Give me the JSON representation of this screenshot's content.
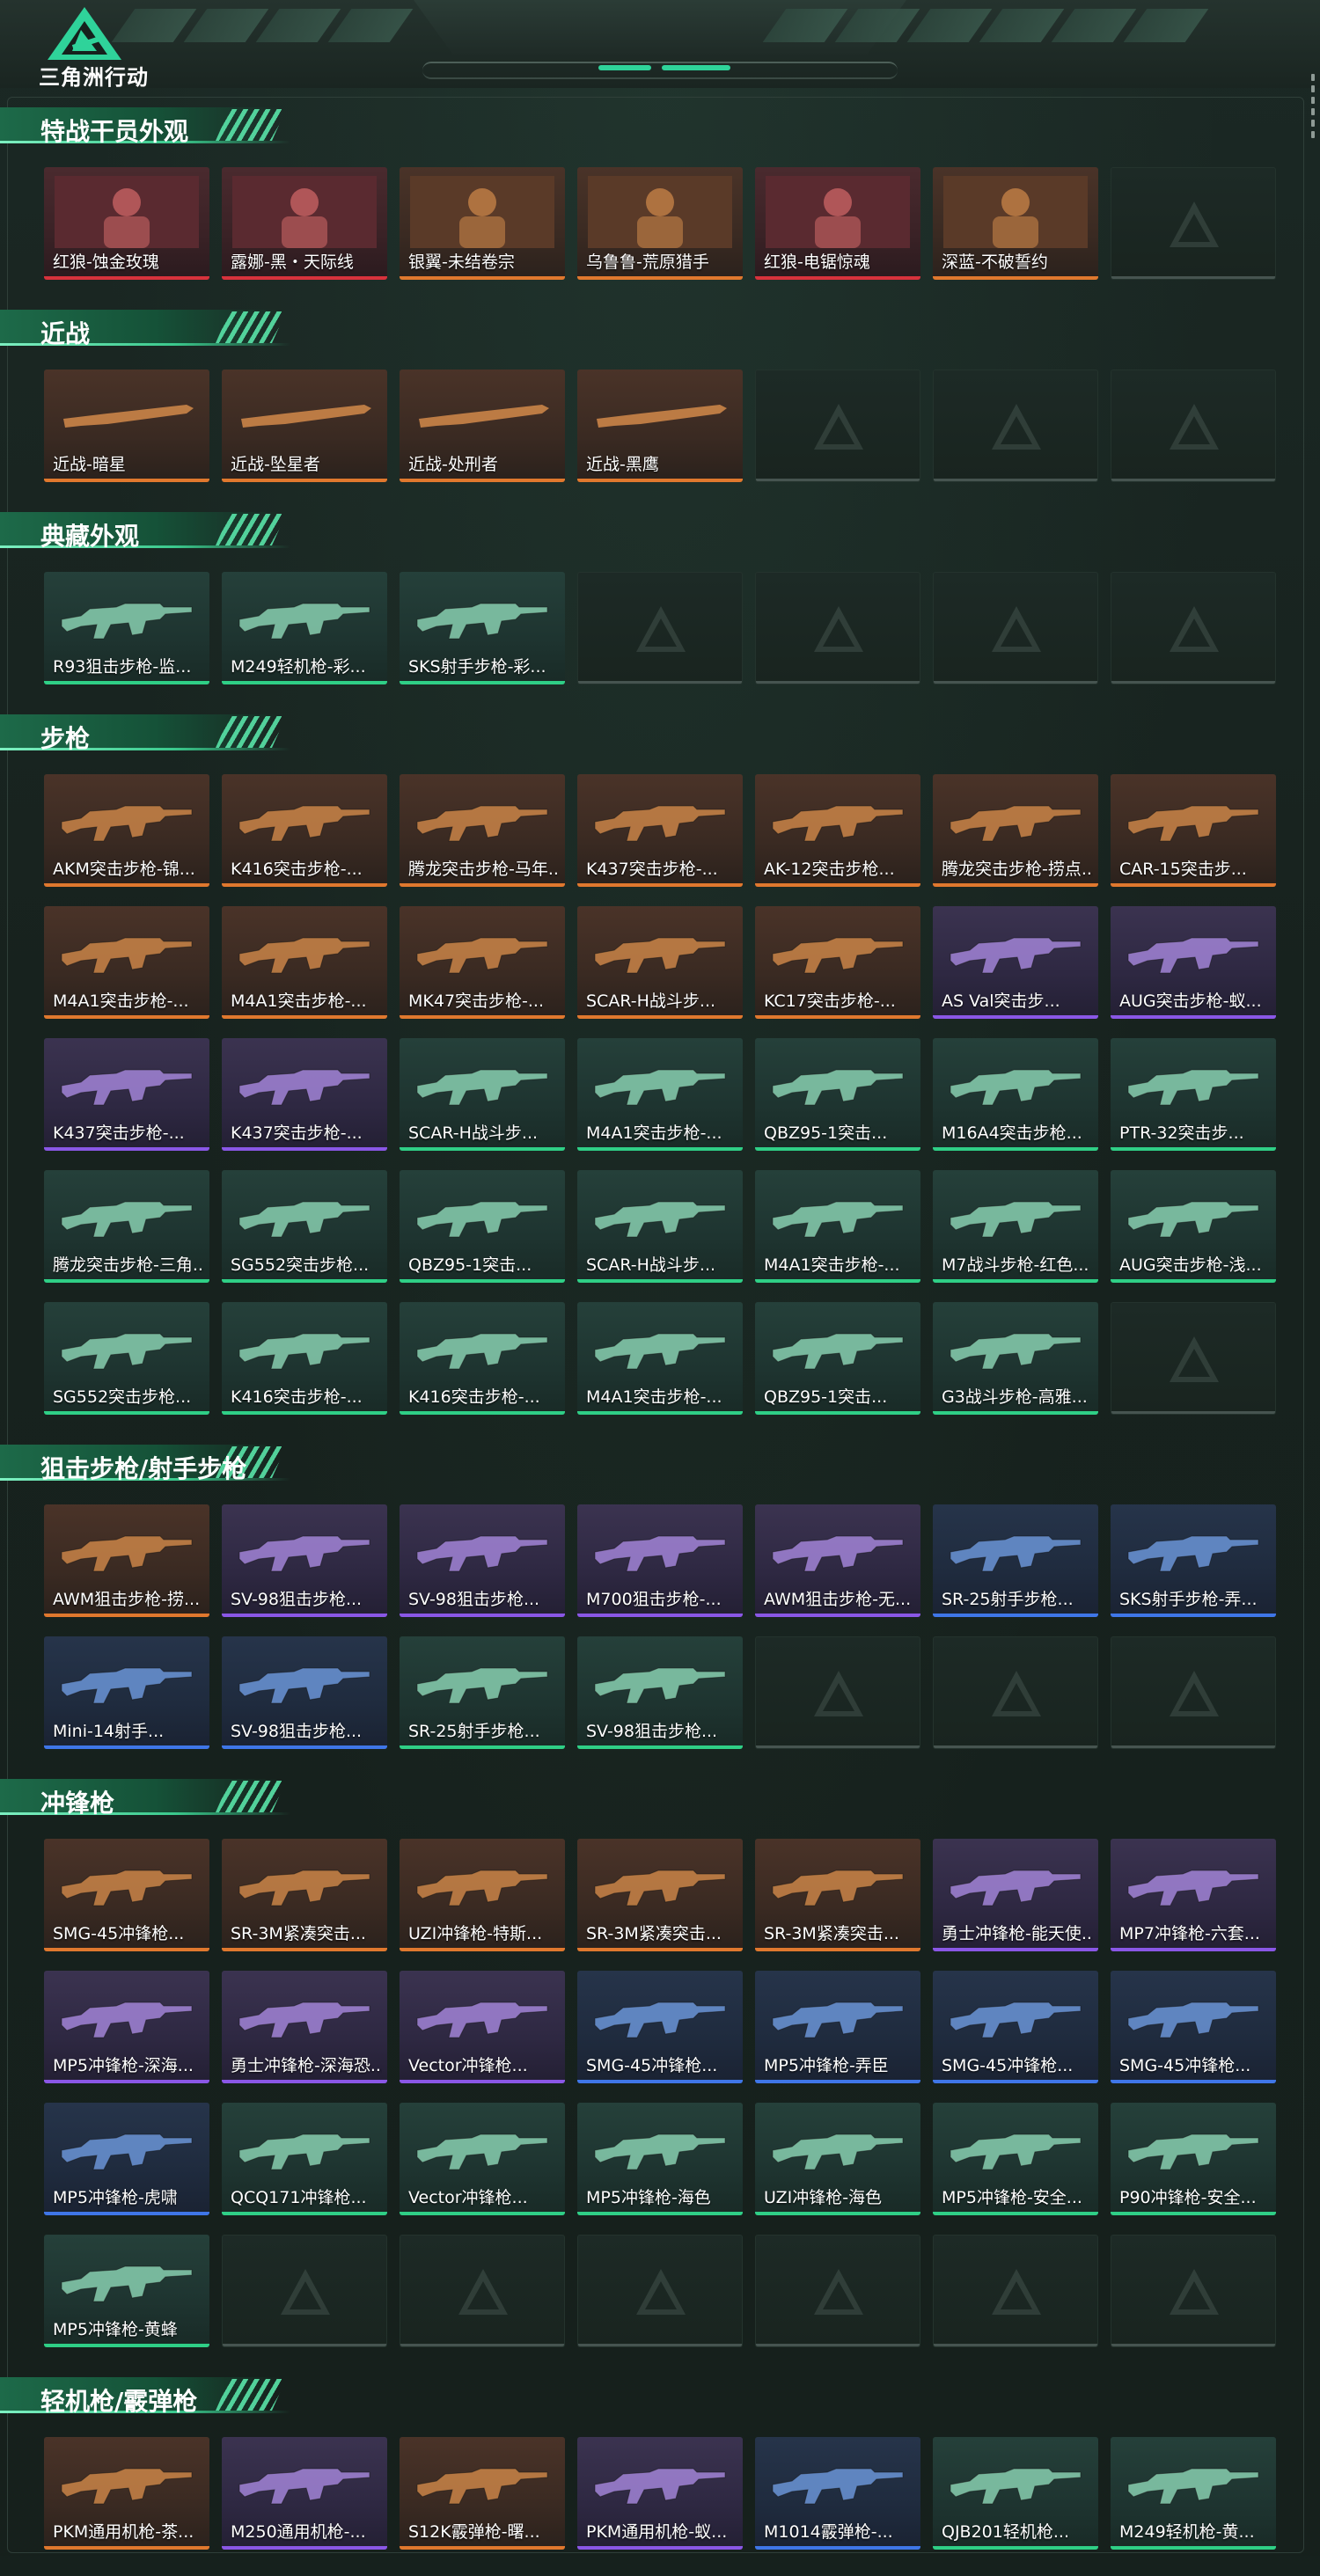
{
  "app": {
    "logo_text": "三角洲行动"
  },
  "colors": {
    "orange": "#e0782e",
    "red": "#d8323c",
    "purple": "#8a57e6",
    "blue": "#3f76e8",
    "green": "#2fcf86",
    "gray": "#bfc6c4",
    "accent": "#2fd39a"
  },
  "sections": [
    {
      "title": "特战干员外观",
      "items": [
        {
          "label": "红狼-蚀金玫瑰",
          "rarity": "red"
        },
        {
          "label": "露娜-黑・天际线",
          "rarity": "red"
        },
        {
          "label": "银翼-未结卷宗",
          "rarity": "orange"
        },
        {
          "label": "乌鲁鲁-荒原猎手",
          "rarity": "orange"
        },
        {
          "label": "红狼-电锯惊魂",
          "rarity": "red"
        },
        {
          "label": "深蓝-不破誓约",
          "rarity": "orange"
        },
        {
          "label": "",
          "rarity": "empty"
        }
      ]
    },
    {
      "title": "近战",
      "items": [
        {
          "label": "近战-暗星",
          "rarity": "orange"
        },
        {
          "label": "近战-坠星者",
          "rarity": "orange"
        },
        {
          "label": "近战-处刑者",
          "rarity": "orange"
        },
        {
          "label": "近战-黑鹰",
          "rarity": "orange"
        },
        {
          "label": "",
          "rarity": "empty"
        },
        {
          "label": "",
          "rarity": "empty"
        },
        {
          "label": "",
          "rarity": "empty"
        }
      ]
    },
    {
      "title": "典藏外观",
      "items": [
        {
          "label": "R93狙击步枪-监...",
          "rarity": "green"
        },
        {
          "label": "M249轻机枪-彩...",
          "rarity": "green"
        },
        {
          "label": "SKS射手步枪-彩...",
          "rarity": "green"
        },
        {
          "label": "",
          "rarity": "empty"
        },
        {
          "label": "",
          "rarity": "empty"
        },
        {
          "label": "",
          "rarity": "empty"
        },
        {
          "label": "",
          "rarity": "empty"
        }
      ]
    },
    {
      "title": "步枪",
      "items": [
        {
          "label": "AKM突击步枪-锦...",
          "rarity": "orange"
        },
        {
          "label": "K416突击步枪-...",
          "rarity": "orange"
        },
        {
          "label": "腾龙突击步枪-马年...",
          "rarity": "orange"
        },
        {
          "label": "K437突击步枪-...",
          "rarity": "orange"
        },
        {
          "label": "AK-12突击步枪...",
          "rarity": "orange"
        },
        {
          "label": "腾龙突击步枪-捞点...",
          "rarity": "orange"
        },
        {
          "label": "CAR-15突击步...",
          "rarity": "orange"
        },
        {
          "label": "M4A1突击步枪-...",
          "rarity": "orange"
        },
        {
          "label": "M4A1突击步枪-...",
          "rarity": "orange"
        },
        {
          "label": "MK47突击步枪-...",
          "rarity": "orange"
        },
        {
          "label": "SCAR-H战斗步...",
          "rarity": "orange"
        },
        {
          "label": "KC17突击步枪-...",
          "rarity": "orange"
        },
        {
          "label": "AS Val突击步...",
          "rarity": "purple"
        },
        {
          "label": "AUG突击步枪-蚁...",
          "rarity": "purple"
        },
        {
          "label": "K437突击步枪-...",
          "rarity": "purple"
        },
        {
          "label": "K437突击步枪-...",
          "rarity": "purple"
        },
        {
          "label": "SCAR-H战斗步...",
          "rarity": "green"
        },
        {
          "label": "M4A1突击步枪-...",
          "rarity": "green"
        },
        {
          "label": "QBZ95-1突击...",
          "rarity": "green"
        },
        {
          "label": "M16A4突击步枪...",
          "rarity": "green"
        },
        {
          "label": "PTR-32突击步...",
          "rarity": "green"
        },
        {
          "label": "腾龙突击步枪-三角...",
          "rarity": "green"
        },
        {
          "label": "SG552突击步枪...",
          "rarity": "green"
        },
        {
          "label": "QBZ95-1突击...",
          "rarity": "green"
        },
        {
          "label": "SCAR-H战斗步...",
          "rarity": "green"
        },
        {
          "label": "M4A1突击步枪-...",
          "rarity": "green"
        },
        {
          "label": "M7战斗步枪-红色...",
          "rarity": "green"
        },
        {
          "label": "AUG突击步枪-浅...",
          "rarity": "green"
        },
        {
          "label": "SG552突击步枪...",
          "rarity": "green"
        },
        {
          "label": "K416突击步枪-...",
          "rarity": "green"
        },
        {
          "label": "K416突击步枪-...",
          "rarity": "green"
        },
        {
          "label": "M4A1突击步枪-...",
          "rarity": "green"
        },
        {
          "label": "QBZ95-1突击...",
          "rarity": "green"
        },
        {
          "label": "G3战斗步枪-高雅...",
          "rarity": "green"
        },
        {
          "label": "",
          "rarity": "empty"
        }
      ]
    },
    {
      "title": "狙击步枪/射手步枪",
      "items": [
        {
          "label": "AWM狙击步枪-捞...",
          "rarity": "orange"
        },
        {
          "label": "SV-98狙击步枪...",
          "rarity": "purple"
        },
        {
          "label": "SV-98狙击步枪...",
          "rarity": "purple"
        },
        {
          "label": "M700狙击步枪-...",
          "rarity": "purple"
        },
        {
          "label": "AWM狙击步枪-无...",
          "rarity": "purple"
        },
        {
          "label": "SR-25射手步枪...",
          "rarity": "blue"
        },
        {
          "label": "SKS射手步枪-弄...",
          "rarity": "blue"
        },
        {
          "label": "Mini-14射手...",
          "rarity": "blue"
        },
        {
          "label": "SV-98狙击步枪...",
          "rarity": "blue"
        },
        {
          "label": "SR-25射手步枪...",
          "rarity": "green"
        },
        {
          "label": "SV-98狙击步枪...",
          "rarity": "green"
        },
        {
          "label": "",
          "rarity": "empty"
        },
        {
          "label": "",
          "rarity": "empty"
        },
        {
          "label": "",
          "rarity": "empty"
        }
      ]
    },
    {
      "title": "冲锋枪",
      "items": [
        {
          "label": "SMG-45冲锋枪...",
          "rarity": "orange"
        },
        {
          "label": "SR-3M紧凑突击...",
          "rarity": "orange"
        },
        {
          "label": "UZI冲锋枪-特斯...",
          "rarity": "orange"
        },
        {
          "label": "SR-3M紧凑突击...",
          "rarity": "orange"
        },
        {
          "label": "SR-3M紧凑突击...",
          "rarity": "orange"
        },
        {
          "label": "勇士冲锋枪-能天使...",
          "rarity": "purple"
        },
        {
          "label": "MP7冲锋枪-六套...",
          "rarity": "purple"
        },
        {
          "label": "MP5冲锋枪-深海...",
          "rarity": "purple"
        },
        {
          "label": "勇士冲锋枪-深海恐...",
          "rarity": "purple"
        },
        {
          "label": "Vector冲锋枪...",
          "rarity": "purple"
        },
        {
          "label": "SMG-45冲锋枪...",
          "rarity": "blue"
        },
        {
          "label": "MP5冲锋枪-弄臣",
          "rarity": "blue"
        },
        {
          "label": "SMG-45冲锋枪...",
          "rarity": "blue"
        },
        {
          "label": "SMG-45冲锋枪...",
          "rarity": "blue"
        },
        {
          "label": "MP5冲锋枪-虎啸",
          "rarity": "blue"
        },
        {
          "label": "QCQ171冲锋枪...",
          "rarity": "green"
        },
        {
          "label": "Vector冲锋枪...",
          "rarity": "green"
        },
        {
          "label": "MP5冲锋枪-海色",
          "rarity": "green"
        },
        {
          "label": "UZI冲锋枪-海色",
          "rarity": "green"
        },
        {
          "label": "MP5冲锋枪-安全...",
          "rarity": "green"
        },
        {
          "label": "P90冲锋枪-安全...",
          "rarity": "green"
        },
        {
          "label": "MP5冲锋枪-黄蜂",
          "rarity": "green"
        },
        {
          "label": "",
          "rarity": "empty"
        },
        {
          "label": "",
          "rarity": "empty"
        },
        {
          "label": "",
          "rarity": "empty"
        },
        {
          "label": "",
          "rarity": "empty"
        },
        {
          "label": "",
          "rarity": "empty"
        },
        {
          "label": "",
          "rarity": "empty"
        }
      ]
    },
    {
      "title": "轻机枪/霰弹枪",
      "items": [
        {
          "label": "PKM通用机枪-茶...",
          "rarity": "orange"
        },
        {
          "label": "M250通用机枪-...",
          "rarity": "purple"
        },
        {
          "label": "S12K霰弹枪-曙...",
          "rarity": "orange"
        },
        {
          "label": "PKM通用机枪-蚁...",
          "rarity": "purple"
        },
        {
          "label": "M1014霰弹枪-...",
          "rarity": "blue"
        },
        {
          "label": "QJB201轻机枪...",
          "rarity": "green"
        },
        {
          "label": "M249轻机枪-黄...",
          "rarity": "green"
        }
      ]
    }
  ]
}
